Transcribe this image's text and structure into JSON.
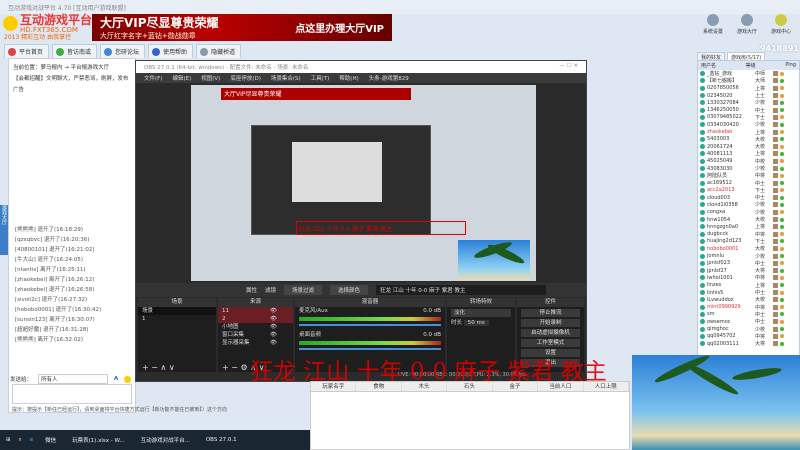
{
  "window": {
    "title": "互动游戏对战平台 4.70 [互动用户游戏联盟]"
  },
  "logo": {
    "name": "互动游戏平台",
    "url": "HD.FXT365.COM",
    "slogan": "2013 精彩互动 由我掌控"
  },
  "banner": {
    "line1": "大厅VIP尽显尊贵荣耀",
    "line2": "大厅红字名字+蓝钻+勋战勋章",
    "cta": "点这里办理大厅VIP"
  },
  "tabs": [
    {
      "label": "平台首页"
    },
    {
      "label": "皆访南或"
    },
    {
      "label": "您研论坛"
    },
    {
      "label": "使用帮助"
    },
    {
      "label": "隐藏桥道"
    }
  ],
  "left": {
    "location": "当前位置：萝马棍内 → 平台棍游戏大厅",
    "notice": "【会都招醒】文明聊大，严禁恶骂，刷屏，发布广告",
    "chat": [
      "[熊熊熊] 退开了(16:18:29)",
      "[qzxqbvc] 退开了(16:20:36)",
      "[40800101] 退开了(16:21:02)",
      "[牛大山] 退开了(16:24:05)",
      "[ntantis] 离开了(16:25:11)",
      "[zhaokebei] 离开了(16:26:12)",
      "[zhaokebei] 退开了(16:26:58)",
      "[sivoli2c] 退开了(16:27:32)",
      "[hobobo0001] 退开了(16:30:42)",
      "[sunsin123] 离开了(16:30:07)",
      "[超超好魔] 退开了(16:31:28)",
      "[熊熊熊] 离开了(16:32:02)"
    ],
    "send_to_label": "发送给：",
    "send_to_value": "所有人",
    "tip": "提示：按提示【新任已经运行】，请到桌面将平台快捷方式运行【新功能不能在已被到】）这个方向",
    "side_tab": "游戏大厅"
  },
  "obs": {
    "title": "OBS 27.0.1 (64-bit, windows) - 配置文件: 未命名 - 场景: 未命名",
    "menu": [
      "文件(F)",
      "编辑(E)",
      "视图(V)",
      "底座停放(D)",
      "场景集合(S)",
      "工具(T)",
      "帮助(H)",
      "头条-游戏第829"
    ],
    "bar": {
      "props": "属性",
      "filters": "滤镜",
      "b1": "场景过滤",
      "b2": "选择颜色",
      "text": "狂龙 江山 十年 0-0 麻子 紫君 教主"
    },
    "docks": {
      "scenes": "场景",
      "sources": "来源",
      "mixer": "混音器",
      "transitions": "转场特效",
      "controls": "控件"
    },
    "scenes": [
      "场景",
      "1"
    ],
    "sources": [
      "11",
      "2",
      "小地图",
      "窗口采集",
      "显示器采集"
    ],
    "mixer": [
      {
        "name": "麦克风/Aux",
        "db": "0.0 dB"
      },
      {
        "name": "桌面音频",
        "db": "0.0 dB"
      }
    ],
    "transition": {
      "type": "淡化",
      "duration_label": "时长",
      "duration": "50 ms"
    },
    "controls": [
      "停止推流",
      "开始录制",
      "启动虚拟摄像机",
      "工作室模式",
      "设置",
      "退出"
    ],
    "status": "LIVE: 00:00:00   REC: 00:00:00   CPU: 2.3%, 30.00 fps"
  },
  "overlay_text": "狂龙 江山 十年 0-0 麻子 紫君 教主",
  "right": {
    "tools": [
      "系统设置",
      "游戏大厅",
      "游戏中心"
    ],
    "user_id": "9418891",
    "tabs": [
      "我的好友",
      "游戏房(5/17)"
    ],
    "headers": [
      "用户名",
      "等级",
      "Ping"
    ],
    "users": [
      [
        "_蓝钻_游戏",
        "中师",
        "#e93"
      ],
      [
        "【新七搬搬】",
        "大师",
        "#3b3"
      ],
      [
        "0207850056",
        "上将",
        "#e93"
      ],
      [
        "02345020",
        "上士",
        "#e93"
      ],
      [
        "1330327084",
        "少校",
        "#3b3"
      ],
      [
        "1346250050",
        "中士",
        "#3b3"
      ],
      [
        "03079485022",
        "下士",
        "#e93"
      ],
      [
        "0334030420",
        "少校",
        "#3b3"
      ],
      [
        "zhaokebei",
        "上将",
        "#e93"
      ],
      [
        "5403003",
        "大校",
        "#3b3"
      ],
      [
        "20061724",
        "大校",
        "#e93"
      ],
      [
        "40081113",
        "上将",
        "#3b3"
      ],
      [
        "45025049",
        "中校",
        "#e93"
      ],
      [
        "43083030",
        "少校",
        "#3b3"
      ],
      [
        "阿陆队员",
        "中将",
        "#e93"
      ],
      [
        "ac169512",
        "中士",
        "#3b3"
      ],
      [
        "acc2a2013",
        "下士",
        "#e93"
      ],
      [
        "cloud003",
        "中士",
        "#3b3"
      ],
      [
        "clond1i0358",
        "少校",
        "#3b3"
      ],
      [
        "congxa",
        "少校",
        "#e93"
      ],
      [
        "hnw1054",
        "大校",
        "#3b3"
      ],
      [
        "hnngzgn0a0",
        "上将",
        "#3b3"
      ],
      [
        "dugbcck",
        "中将",
        "#e93"
      ],
      [
        "huajing2d123",
        "下士",
        "#3b3"
      ],
      [
        "hobobo0001",
        "大校",
        "#e93"
      ],
      [
        "jomnlu",
        "少校",
        "#3b3"
      ],
      [
        "jpnlsf023",
        "中士",
        "#e93"
      ],
      [
        "jpnlsf27",
        "大将",
        "#3b3"
      ],
      [
        "lwhoi1001",
        "中将",
        "#e93"
      ],
      [
        "linzes",
        "上将",
        "#3b3"
      ],
      [
        "linhis5",
        "中士",
        "#e93"
      ],
      [
        "lLvwuddoz",
        "大校",
        "#3b3"
      ],
      [
        "mint0990929",
        "中将",
        "#e93"
      ],
      [
        "sm",
        "中士",
        "#3b3"
      ],
      [
        "owsemoc",
        "中士",
        "#e93"
      ],
      [
        "qimghoc",
        "少校",
        "#3b3"
      ],
      [
        "qq0945702",
        "中将",
        "#e93"
      ],
      [
        "qq02003111",
        "大将",
        "#3b3"
      ]
    ]
  },
  "bottom_table": {
    "headers": [
      "玩家名字",
      "食物",
      "木头",
      "石头",
      "金子",
      "当前人口",
      "人口上限"
    ]
  },
  "taskbar": {
    "items": [
      "微信",
      "玩票表(1).xlsx - W...",
      "互动游戏对战平台...",
      "OBS 27.0.1"
    ]
  }
}
